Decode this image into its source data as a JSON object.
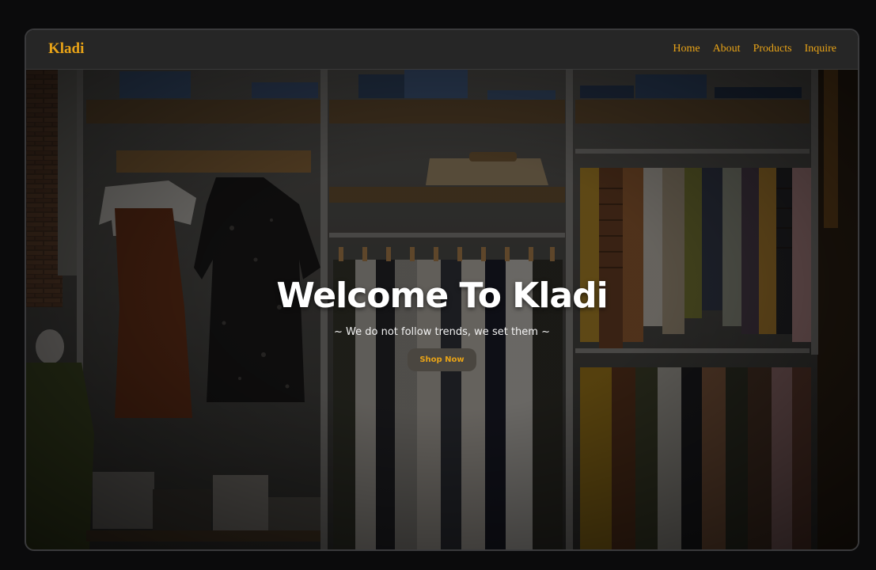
{
  "brand": {
    "name": "Kladi"
  },
  "nav": {
    "items": [
      {
        "label": "Home"
      },
      {
        "label": "About"
      },
      {
        "label": "Products"
      },
      {
        "label": "Inquire"
      }
    ]
  },
  "hero": {
    "title": "Welcome To Kladi",
    "tagline": "~ We do not follow trends, we set them ~",
    "cta_label": "Shop Now"
  },
  "colors": {
    "accent": "#e8a317",
    "page_bg": "#0b0b0c",
    "navbar_bg": "#262626",
    "button_bg": "#4a4640"
  }
}
